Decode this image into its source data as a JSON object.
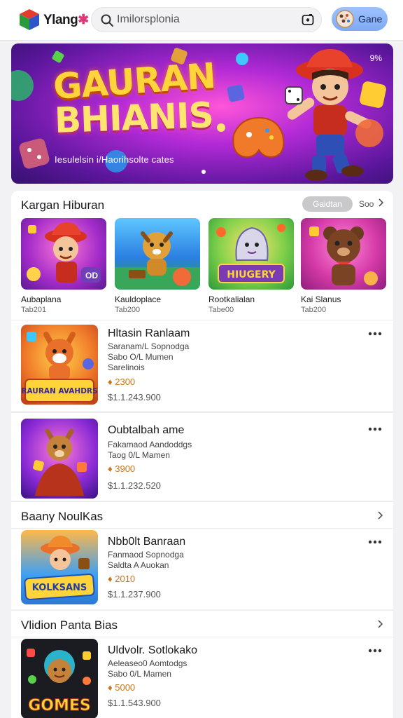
{
  "header": {
    "logo_text": "Ylang",
    "logo_accent": "✱",
    "search_placeholder": "Imilorsplonia",
    "pill_label": "Gane"
  },
  "hero": {
    "title_line1": "GAURAN",
    "title_line2": "BHIANIS",
    "subtitle": "Iesulelsin i/Haorihsolte cates",
    "badge": "9%"
  },
  "section1": {
    "title": "Kargan Hiburan",
    "pill": "Gaidtan",
    "see_all": "Soo",
    "tiles": [
      {
        "name": "Aubaplana",
        "price": "Tab201",
        "icon": "cowboy-boy-game-icon"
      },
      {
        "name": "Kauldoplace",
        "price": "Tab200",
        "icon": "dog-on-table-game-icon"
      },
      {
        "name": "Rootkalialan",
        "price": "Tabe00",
        "icon": "grey-creature-game-icon"
      },
      {
        "name": "Kai Slanus",
        "price": "Tab200",
        "icon": "brown-bear-game-icon"
      }
    ],
    "tile3_art_text": "HIUGERY"
  },
  "rows": [
    {
      "title": "Hltasin Ranlaam",
      "line1": "Saranam/L Sopnodga",
      "line2": "Sabo O/L Mumen",
      "line3": "Sarelinois",
      "badge": "♦ 2300",
      "price": "$1.1.243.900",
      "art_text": "RAURAN AVAHDRS"
    },
    {
      "title": "Oubtalbah ame",
      "line1": "Fakamaod Aandoddgs",
      "line2": "Taog 0/L Mamen",
      "badge": "♦ 3900",
      "price": "$1.1.232.520"
    }
  ],
  "section2": {
    "title": "Baany NoulKas",
    "row": {
      "title": "Nbb0lt Banraan",
      "line1": "Fanmaod Sopnodga",
      "line2": "Saldta A Auokan",
      "badge": "♦ 2010",
      "price": "$1.1.237.900",
      "art_text": "KOLKSANS"
    }
  },
  "section3": {
    "title": "Vlidion Panta Bias",
    "row": {
      "title": "Uldvolr. Sotlokako",
      "line1": "Aeleaseo0 Aomtodgs",
      "line2": "Sabo 0/L Mamen",
      "badge": "♦ 5000",
      "price": "$1.1.543.900",
      "art_text": "GOMES"
    }
  },
  "colors": {
    "accent_blue": "#8fb6fa",
    "badge_orange": "#c8761a",
    "hero_purple": "#b12ad6"
  }
}
